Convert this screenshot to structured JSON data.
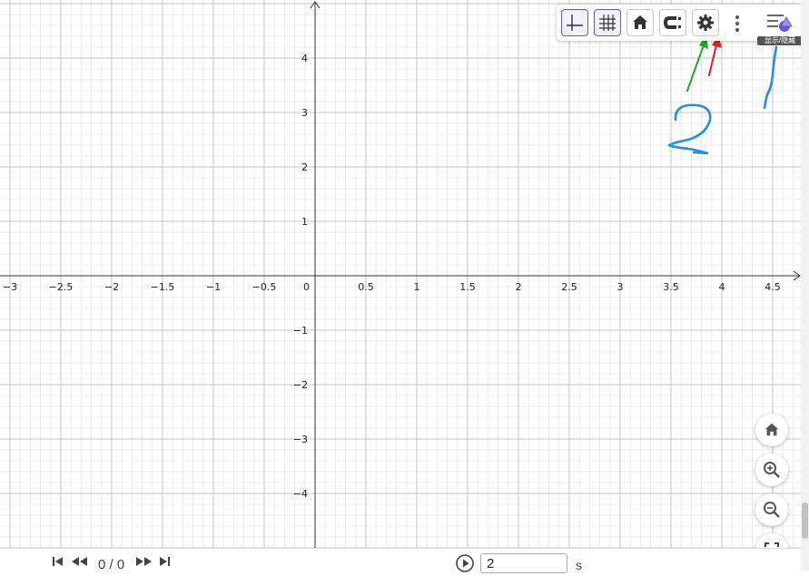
{
  "graph": {
    "x_ticks": [
      "−3",
      "−2.5",
      "−2",
      "−1.5",
      "−1",
      "−0.5",
      "0",
      "0.5",
      "1",
      "1.5",
      "2",
      "2.5",
      "3",
      "3.5",
      "4",
      "4.5"
    ],
    "y_ticks": [
      "4",
      "3",
      "2",
      "1",
      "−1",
      "−2",
      "−3",
      "−4"
    ],
    "ink_color": "#1e90e6"
  },
  "toolbar": {
    "buttons": [
      {
        "name": "axes-toggle",
        "icon": "axes-icon",
        "active": true
      },
      {
        "name": "grid-toggle",
        "icon": "grid-icon",
        "active": true
      },
      {
        "name": "standard-view",
        "icon": "home-icon"
      },
      {
        "name": "capture-style",
        "icon": "magnet-icon"
      },
      {
        "name": "graphics-settings",
        "icon": "gear-icon"
      }
    ],
    "more_icon": "more-vertical-icon",
    "algebra_icon": "algebra-view-icon",
    "tooltip_text": "显示/隐藏"
  },
  "zoom_controls": [
    {
      "name": "standard-view",
      "icon": "home-icon"
    },
    {
      "name": "zoom-in",
      "icon": "zoom-in-icon"
    },
    {
      "name": "zoom-out",
      "icon": "zoom-out-icon"
    },
    {
      "name": "fullscreen",
      "icon": "fullscreen-icon"
    }
  ],
  "playback": {
    "counter": "0 / 0",
    "speed_value": "2",
    "unit": "s",
    "icons": [
      "skip-start-icon",
      "rewind-icon",
      "fast-forward-icon",
      "skip-end-icon",
      "play-icon"
    ]
  },
  "annotations": {
    "arrow_colors": [
      "#22aa22",
      "#e02020"
    ]
  }
}
